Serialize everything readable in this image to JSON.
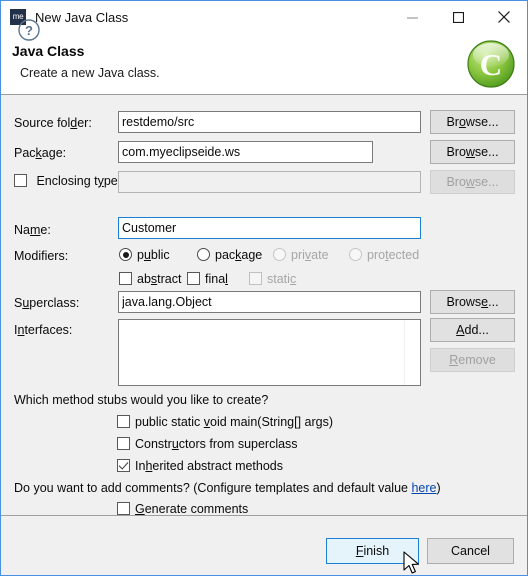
{
  "window": {
    "title": "New Java Class",
    "icon": "myeclipse-me-icon",
    "icon_text": "me",
    "minimize_label": "Minimize",
    "maximize_label": "Maximize",
    "close_label": "Close"
  },
  "banner": {
    "title": "Java Class",
    "subtitle": "Create a new Java class.",
    "logo": "green-java-class-wizard-icon"
  },
  "form": {
    "source_folder": {
      "label_pre": "Source fol",
      "label_mnemonic": "d",
      "label_post": "er:",
      "value": "restdemo/src",
      "browse_pre": "Br",
      "browse_mnemonic": "o",
      "browse_post": "wse..."
    },
    "package": {
      "label_pre": "Pac",
      "label_mnemonic": "k",
      "label_post": "age:",
      "value": "com.myeclipseide.ws",
      "browse_pre": "Bro",
      "browse_mnemonic": "w",
      "browse_post": "se..."
    },
    "enclosing_type": {
      "label_pre": "Enclosing t",
      "label_mnemonic": "y",
      "label_post": "pe:",
      "value": "",
      "checked": false,
      "enabled": false,
      "browse_pre": "Bro",
      "browse_mnemonic": "w",
      "browse_post": "se..."
    },
    "name": {
      "label_pre": "Na",
      "label_mnemonic": "m",
      "label_post": "e:",
      "value": "Customer",
      "focused": true
    },
    "modifiers": {
      "label": "Modifiers:",
      "radios": [
        {
          "pre": "p",
          "mnemonic": "u",
          "post": "blic",
          "selected": true,
          "enabled": true
        },
        {
          "pre": "pac",
          "mnemonic": "k",
          "post": "age",
          "selected": false,
          "enabled": true
        },
        {
          "pre": "pri",
          "mnemonic": "v",
          "post": "ate",
          "selected": false,
          "enabled": false
        },
        {
          "pre": "pro",
          "mnemonic": "t",
          "post": "ected",
          "selected": false,
          "enabled": false
        }
      ],
      "checkboxes": [
        {
          "pre": "ab",
          "mnemonic": "s",
          "post": "tract",
          "checked": false,
          "enabled": true
        },
        {
          "pre": "fina",
          "mnemonic": "l",
          "post": "",
          "checked": false,
          "enabled": true
        },
        {
          "pre": "stati",
          "mnemonic": "c",
          "post": "",
          "checked": false,
          "enabled": false
        }
      ]
    },
    "superclass": {
      "label_pre": "S",
      "label_mnemonic": "u",
      "label_post": "perclass:",
      "value": "java.lang.Object",
      "browse_pre": "Brows",
      "browse_mnemonic": "e",
      "browse_post": "..."
    },
    "interfaces": {
      "label_pre": "I",
      "label_mnemonic": "n",
      "label_post": "terfaces:",
      "items": [],
      "add_pre": "",
      "add_mnemonic": "A",
      "add_post": "dd...",
      "remove_pre": "",
      "remove_mnemonic": "R",
      "remove_post": "emove",
      "remove_enabled": false
    },
    "stubs": {
      "question": "Which method stubs would you like to create?",
      "options": [
        {
          "pre": "public static ",
          "mnemonic": "v",
          "post": "oid main(String[] args)",
          "checked": false
        },
        {
          "pre": "Constr",
          "mnemonic": "u",
          "post": "ctors from superclass",
          "checked": false
        },
        {
          "pre": "In",
          "mnemonic": "h",
          "post": "erited abstract methods",
          "checked": true
        }
      ]
    },
    "comments": {
      "question_pre": "Do you want to add comments? (Configure templates and default value ",
      "link": "here",
      "question_post": ")",
      "option": {
        "pre": "",
        "mnemonic": "G",
        "post": "enerate comments",
        "checked": false
      }
    }
  },
  "footer": {
    "help_label": "?",
    "finish_pre": "",
    "finish_mnemonic": "F",
    "finish_post": "inish",
    "cancel_label": "Cancel"
  },
  "colors": {
    "window_border": "#4a90e2",
    "body_background": "#f0f0f0",
    "banner_background": "#ffffff",
    "focus_border": "#1c7fd6",
    "link": "#0645ad",
    "logo_green": "#7fc241",
    "icon_navy": "#23304a"
  }
}
